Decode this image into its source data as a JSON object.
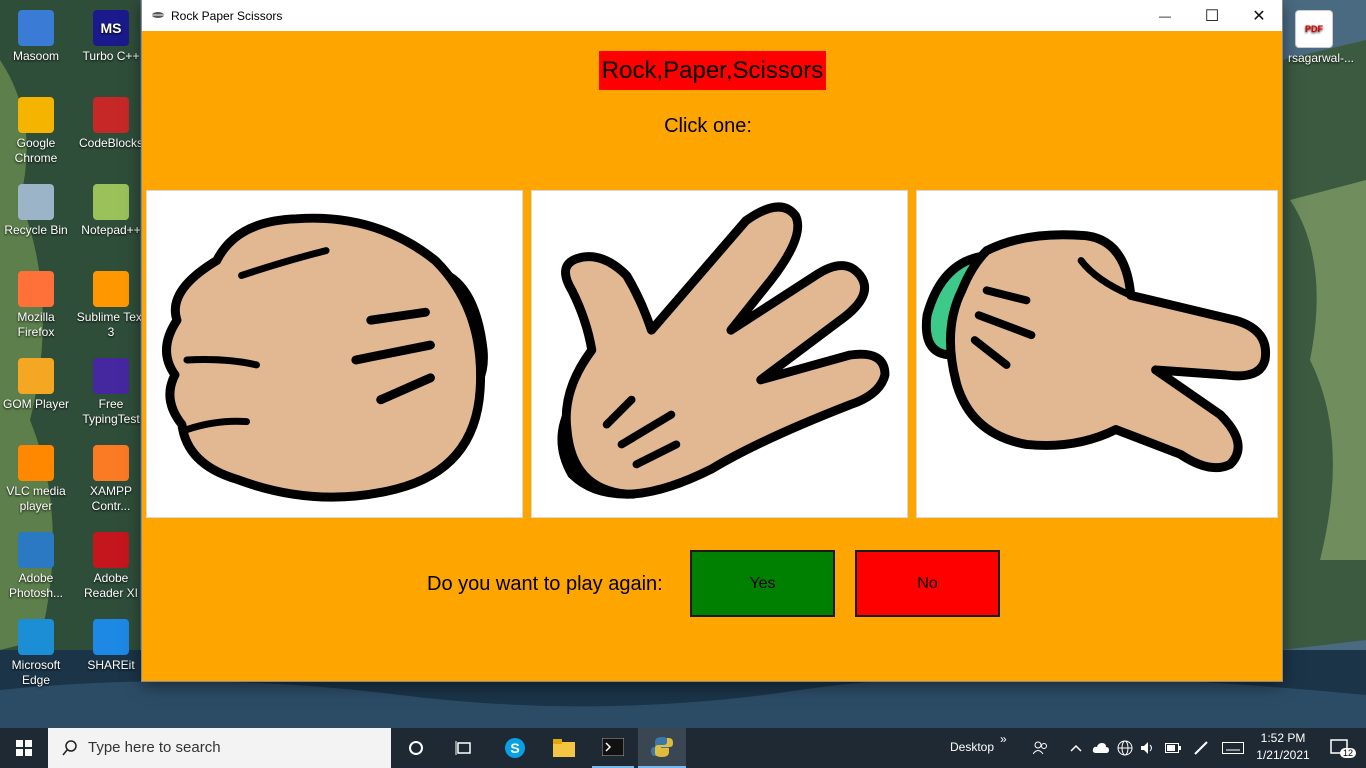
{
  "desktop": {
    "icons_left": [
      {
        "label": "Masoom",
        "name": "desktop-icon-masoom"
      },
      {
        "label": "Google Chrome",
        "name": "desktop-icon-chrome"
      },
      {
        "label": "Recycle Bin",
        "name": "desktop-icon-recycle-bin"
      },
      {
        "label": "Mozilla Firefox",
        "name": "desktop-icon-firefox"
      },
      {
        "label": "GOM Player",
        "name": "desktop-icon-gom-player"
      },
      {
        "label": "VLC media player",
        "name": "desktop-icon-vlc"
      },
      {
        "label": "Adobe Photosh...",
        "name": "desktop-icon-photoshop"
      },
      {
        "label": "Microsoft Edge",
        "name": "desktop-icon-edge"
      }
    ],
    "icons_right": [
      {
        "label": "Turbo C++",
        "name": "desktop-icon-turbo-cpp",
        "badge": "MS"
      },
      {
        "label": "CodeBlocks",
        "name": "desktop-icon-codeblocks"
      },
      {
        "label": "Notepad++",
        "name": "desktop-icon-notepadpp"
      },
      {
        "label": "Sublime Text 3",
        "name": "desktop-icon-sublime"
      },
      {
        "label": "Free TypingTest",
        "name": "desktop-icon-typingtest"
      },
      {
        "label": "XAMPP Contr...",
        "name": "desktop-icon-xampp"
      },
      {
        "label": "Adobe Reader XI",
        "name": "desktop-icon-adobe-reader"
      },
      {
        "label": "SHAREit",
        "name": "desktop-icon-shareit"
      }
    ],
    "pdf_icon": {
      "label": "rsagarwal-...",
      "badge": "PDF"
    }
  },
  "window": {
    "title": "Rock Paper Scissors",
    "controls": {
      "minimize": "—",
      "maximize": "☐",
      "close": "✕"
    },
    "game_title": "Rock,Paper,Scissors",
    "prompt": "Click one:",
    "choices": [
      "rock",
      "paper",
      "scissors"
    ],
    "play_again_label": "Do you want to play again:",
    "yes_label": "Yes",
    "no_label": "No",
    "colors": {
      "background": "#ffa500",
      "title_bg": "#ff0000",
      "yes_bg": "#008000",
      "no_bg": "#ff0000",
      "skin": "#e2b893",
      "cuff": "#3cc98a"
    }
  },
  "taskbar": {
    "search_placeholder": "Type here to search",
    "desktop_label": "Desktop",
    "chevron": "»",
    "time": "1:52 PM",
    "date": "1/21/2021",
    "notification_count": "12"
  }
}
